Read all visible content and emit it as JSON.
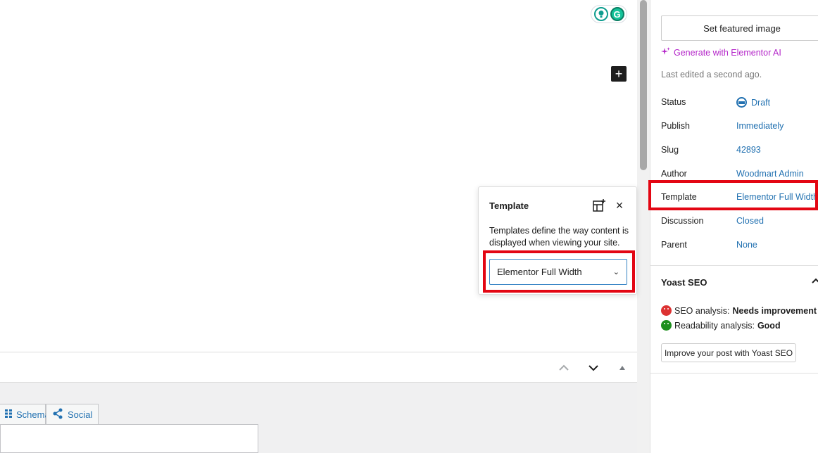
{
  "canvas": {
    "extension_icons": [
      "lightbulb-icon",
      "grammarly-icon"
    ],
    "grammarly_letter": "G",
    "add_block_symbol": "+"
  },
  "template_popover": {
    "title": "Template",
    "close_symbol": "×",
    "description": "Templates define the way content is displayed when viewing your site.",
    "selected_template": "Elementor Full Width"
  },
  "metabox": {
    "tabs": [
      {
        "label": "Schema",
        "icon": "grid-icon"
      },
      {
        "label": "Social",
        "icon": "share-icon"
      }
    ]
  },
  "sidebar": {
    "featured_image_button": "Set featured image",
    "generate_ai_link": "Generate with Elementor AI",
    "last_edited": "Last edited a second ago.",
    "rows": [
      {
        "key": "Status",
        "value": "Draft"
      },
      {
        "key": "Publish",
        "value": "Immediately"
      },
      {
        "key": "Slug",
        "value": "42893"
      },
      {
        "key": "Author",
        "value": "Woodmart Admin"
      },
      {
        "key": "Template",
        "value": "Elementor Full Width"
      },
      {
        "key": "Discussion",
        "value": "Closed"
      },
      {
        "key": "Parent",
        "value": "None"
      }
    ],
    "yoast": {
      "title": "Yoast SEO",
      "seo_label": "SEO analysis: ",
      "seo_value": "Needs improvement",
      "readability_label": "Readability analysis: ",
      "readability_value": "Good",
      "improve_button": "Improve your post with Yoast SEO"
    }
  },
  "colors": {
    "highlight_red": "#e30613",
    "link_blue": "#2271b1",
    "ai_purple": "#b426c9"
  }
}
